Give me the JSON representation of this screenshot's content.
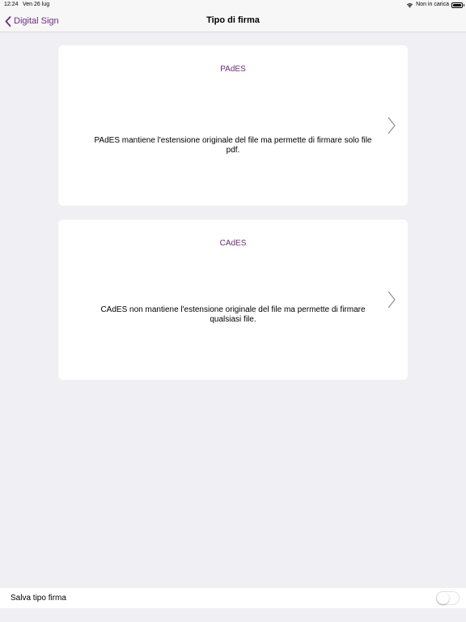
{
  "status_bar": {
    "time": "12:24",
    "date": "Ven 26 lug",
    "charging_status": "Non in carica"
  },
  "nav": {
    "back_label": "Digital Sign",
    "title": "Tipo di firma"
  },
  "options": [
    {
      "title": "PAdES",
      "description": "PAdES mantiene l'estensione originale del file ma permette di firmare solo file pdf."
    },
    {
      "title": "CAdES",
      "description": "CAdES non mantiene l'estensione originale del file ma permette di firmare qualsiasi file."
    }
  ],
  "footer": {
    "save_label": "Salva tipo firma",
    "toggle_on": false
  },
  "colors": {
    "accent": "#6e2a7e",
    "background": "#efeff4",
    "card": "#ffffff"
  }
}
